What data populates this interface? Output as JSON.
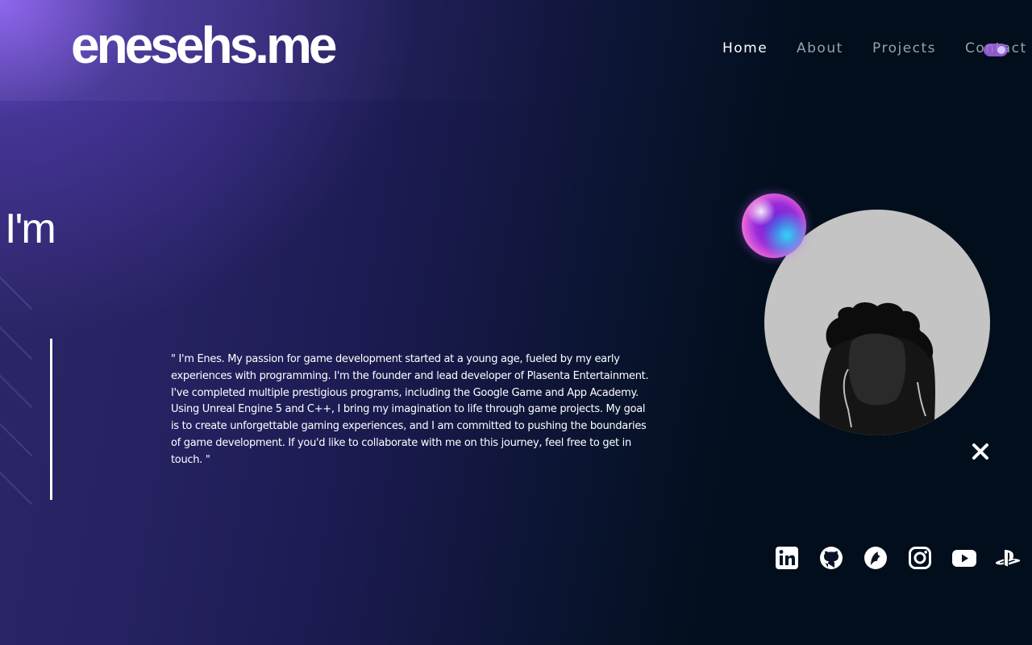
{
  "site": {
    "logo": "enesehs.me"
  },
  "nav": {
    "items": [
      {
        "label": "Home",
        "active": true
      },
      {
        "label": "About",
        "active": false
      },
      {
        "label": "Projects",
        "active": false
      },
      {
        "label": "Contact",
        "active": false
      }
    ],
    "theme_toggle": {
      "state": "on",
      "color": "#a768e8"
    }
  },
  "hero": {
    "greeting": "I'm",
    "bio": "\" I'm Enes. My passion for game development started at a young age, fueled by my early experiences with programming. I'm the founder and lead developer of Plasenta Entertainment. I've completed multiple prestigious programs, including the Google Game and App Academy. Using Unreal Engine 5 and C++, I bring my imagination to life through game projects. My goal is to create unforgettable gaming experiences, and I am committed to pushing the boundaries of game development. If you'd like to collaborate with me on this journey, feel free to get in touch. \""
  },
  "icons": {
    "close": "close-icon",
    "social": [
      "linkedin-icon",
      "github-icon",
      "kaggle-bird-icon",
      "instagram-icon",
      "youtube-icon",
      "playstation-icon"
    ]
  },
  "colors": {
    "accent": "#8f62f6",
    "background": "#020e1c",
    "text": "#ffffff"
  }
}
